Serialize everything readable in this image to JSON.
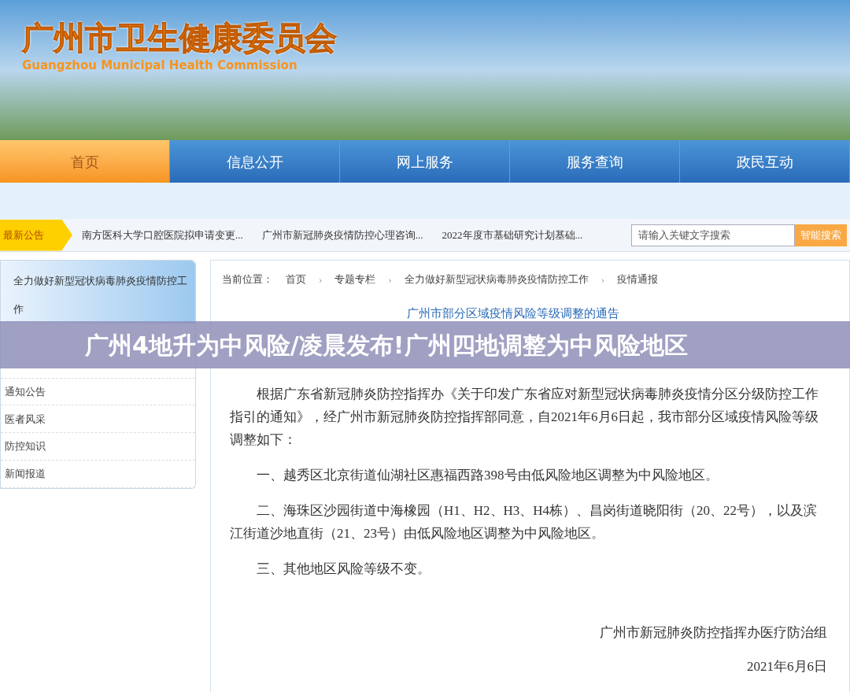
{
  "header": {
    "title": "广州市卫生健康委员会",
    "subtitle": "Guangzhou Municipal Health Commission"
  },
  "nav": [
    {
      "label": "首页",
      "selected": true
    },
    {
      "label": "信息公开",
      "selected": false
    },
    {
      "label": "网上服务",
      "selected": false
    },
    {
      "label": "服务查询",
      "selected": false
    },
    {
      "label": "政民互动",
      "selected": false
    }
  ],
  "notice_bar": {
    "label": "最新公告",
    "items": [
      "南方医科大学口腔医院拟申请变更...",
      "广州市新冠肺炎疫情防控心理咨询...",
      "2022年度市基础研究计划基础..."
    ],
    "search": {
      "placeholder": "请输入关键文字搜索",
      "button": "智能搜索"
    }
  },
  "sidebar": {
    "title": "全力做好新型冠状病毒肺炎疫情防控工作",
    "items": [
      {
        "label": "通知公告",
        "selected": false
      },
      {
        "label": "医者风采",
        "selected": false
      },
      {
        "label": "防控知识",
        "selected": false
      },
      {
        "label": "新闻报道",
        "selected": false
      }
    ]
  },
  "breadcrumb": {
    "label": "当前位置：",
    "separator": "›",
    "items": [
      "首页",
      "专题专栏",
      "全力做好新型冠状病毒肺炎疫情防控工作",
      "疫情通报"
    ]
  },
  "article": {
    "title": "广州市部分区域疫情风险等级调整的通告",
    "paragraphs": [
      "根据广东省新冠肺炎防控指挥办《关于印发广东省应对新型冠状病毒肺炎疫情分区分级防控工作指引的通知》，经广州市新冠肺炎防控指挥部同意，自2021年6月6日起，我市部分区域疫情风险等级调整如下：",
      "一、越秀区北京街道仙湖社区惠福西路398号由低风险地区调整为中风险地区。",
      "二、海珠区沙园街道中海橡园（H1、H2、H3、H4栋）、昌岗街道晓阳街（20、22号），以及滨江街道沙地直街（21、23号）由低风险地区调整为中风险地区。",
      "三、其他地区风险等级不变。"
    ],
    "signature": "广州市新冠肺炎防控指挥办医疗防治组",
    "date": "2021年6月6日"
  },
  "overlay_caption": "广州4地升为中风险/凌晨发布!广州四地调整为中风险地区"
}
